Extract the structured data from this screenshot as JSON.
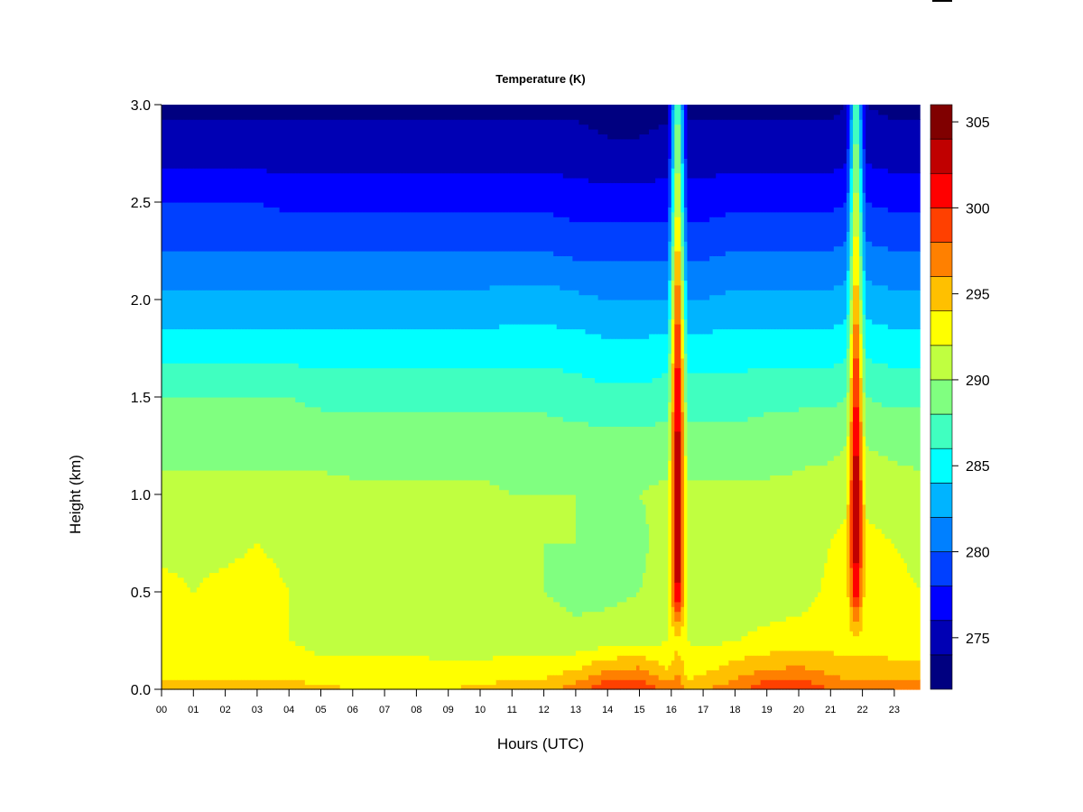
{
  "chart_data": {
    "type": "heatmap",
    "title": "Temperature (K)",
    "xlabel": "Hours (UTC)",
    "ylabel": "Height (km)",
    "xlim": [
      0,
      23.8
    ],
    "ylim": [
      0,
      3.0
    ],
    "x_ticks": [
      "00",
      "01",
      "02",
      "03",
      "04",
      "05",
      "06",
      "07",
      "08",
      "09",
      "10",
      "11",
      "12",
      "13",
      "14",
      "15",
      "16",
      "17",
      "18",
      "19",
      "20",
      "21",
      "22",
      "23"
    ],
    "y_ticks": [
      "0.0",
      "0.5",
      "1.0",
      "1.5",
      "2.0",
      "2.5",
      "3.0"
    ],
    "colorbar": {
      "levels_min": 272,
      "levels_max": 306,
      "level_step": 2,
      "ticks": [
        "275",
        "280",
        "285",
        "290",
        "295",
        "300",
        "305"
      ],
      "colors": [
        "#000080",
        "#0000B4",
        "#0000FF",
        "#0040FF",
        "#0080FF",
        "#00B4FF",
        "#00FFFF",
        "#40FFC0",
        "#80FF80",
        "#C0FF40",
        "#FFFF00",
        "#FFC000",
        "#FF8000",
        "#FF4000",
        "#FF0000",
        "#C00000",
        "#800000"
      ]
    },
    "heights_km": [
      0,
      0.1,
      0.25,
      0.5,
      0.75,
      1.0,
      1.25,
      1.5,
      1.75,
      2.0,
      2.25,
      2.5,
      2.75,
      3.0
    ],
    "hours": [
      0,
      1,
      2,
      3,
      4,
      5,
      6,
      7,
      8,
      9,
      10,
      11,
      12,
      13,
      14,
      15,
      15.9,
      16.2,
      16.5,
      17,
      18,
      19,
      20,
      21,
      21.5,
      21.8,
      22.1,
      23,
      23.8
    ],
    "temperature_by_hour": [
      [
        295,
        293,
        292,
        292.5,
        291.5,
        290.5,
        289.5,
        288,
        285,
        282.5,
        280,
        278,
        275,
        273.5
      ],
      [
        295,
        293,
        292,
        292,
        291.5,
        290.5,
        289.5,
        288,
        285,
        282.5,
        280,
        278,
        275,
        273.5
      ],
      [
        295,
        293,
        292,
        292.5,
        291.5,
        290.5,
        289.5,
        288,
        285,
        282.5,
        280,
        278,
        275,
        273.5
      ],
      [
        295,
        293,
        292,
        292.8,
        292,
        290.5,
        289.5,
        288,
        285,
        282.5,
        280,
        278,
        275,
        273.5
      ],
      [
        295,
        293,
        292,
        292,
        291.5,
        290.5,
        289.5,
        288,
        285,
        282.5,
        280,
        277.5,
        275,
        273.5
      ],
      [
        294.5,
        292.5,
        291.5,
        291.5,
        291,
        290.5,
        289.5,
        287.5,
        285,
        282.5,
        280,
        277.5,
        275,
        273.5
      ],
      [
        294,
        292.5,
        291.5,
        291,
        290.5,
        290.5,
        289,
        287.5,
        285,
        282.5,
        280,
        277.5,
        275,
        273.5
      ],
      [
        294,
        292.5,
        291.5,
        291,
        290.5,
        290.5,
        289,
        287.5,
        285,
        282.5,
        280,
        277.5,
        275,
        273.5
      ],
      [
        294,
        292.5,
        291.5,
        291,
        290.5,
        290.5,
        289,
        287.5,
        285,
        282.5,
        280,
        277.5,
        275,
        273.5
      ],
      [
        294,
        292.5,
        291,
        290.5,
        290.5,
        290.5,
        289,
        287.5,
        285,
        282.5,
        280,
        277.5,
        275,
        273.5
      ],
      [
        294.5,
        292.5,
        291,
        290.5,
        290.5,
        290.5,
        289,
        287.5,
        285,
        282.5,
        280,
        277.5,
        275,
        273.5
      ],
      [
        295,
        293,
        291,
        290,
        290,
        290,
        289,
        287.5,
        285,
        283,
        280,
        277.5,
        275,
        273.5
      ],
      [
        295.5,
        293,
        291,
        290,
        290,
        290,
        289,
        287.5,
        285,
        283,
        280,
        277.5,
        275,
        273.5
      ],
      [
        297,
        294,
        290.5,
        289.5,
        290,
        290,
        289,
        287,
        285,
        282.5,
        279.5,
        277,
        275,
        273.5
      ],
      [
        300,
        296,
        291,
        289.5,
        289.5,
        290,
        289,
        286.5,
        284.5,
        282,
        279.5,
        277,
        274.5,
        273
      ],
      [
        300,
        296.5,
        291,
        290,
        289.5,
        290,
        289,
        286.5,
        284.5,
        282,
        279.5,
        277,
        274.5,
        273
      ],
      [
        297,
        294,
        292,
        291,
        291,
        290.5,
        289,
        287,
        285,
        282,
        279.5,
        277,
        275,
        273.5
      ],
      [
        298,
        296,
        293,
        304,
        305,
        305.5,
        305,
        304,
        302,
        300,
        297,
        294,
        292,
        290
      ],
      [
        295,
        293,
        292,
        291,
        290.5,
        290.5,
        289,
        287,
        285,
        282,
        279.5,
        277,
        275,
        273.5
      ],
      [
        296,
        293.5,
        291.5,
        290.5,
        290.5,
        290.5,
        289,
        287,
        285,
        282,
        279.5,
        277,
        275,
        273.5
      ],
      [
        297,
        295,
        292,
        290.5,
        290.5,
        290.5,
        289,
        287,
        285,
        282.5,
        280,
        277.5,
        275,
        273.5
      ],
      [
        300,
        296,
        292.5,
        291,
        290.5,
        290.5,
        289,
        287.5,
        285,
        282.5,
        280,
        277.5,
        275,
        273.5
      ],
      [
        300,
        296.5,
        293,
        291,
        291,
        290.5,
        289.5,
        287.5,
        285,
        282.5,
        280,
        277.5,
        275,
        273.5
      ],
      [
        298,
        295.5,
        293,
        292.5,
        292,
        291,
        289.5,
        287.5,
        285,
        282.5,
        280,
        277.5,
        275,
        273.5
      ],
      [
        297,
        295,
        293,
        292.5,
        292.5,
        291.5,
        290,
        288,
        285.5,
        283,
        280.5,
        278,
        275.5,
        274
      ],
      [
        297,
        295,
        293,
        302,
        305,
        305.5,
        304,
        302,
        300,
        297,
        295,
        293,
        291,
        289
      ],
      [
        297,
        295,
        293,
        292.5,
        292.5,
        291.5,
        290,
        288,
        285.5,
        283,
        280.5,
        278,
        275.5,
        274
      ],
      [
        297,
        295,
        292.5,
        292.5,
        292,
        291,
        289.5,
        287.5,
        285,
        282.5,
        280,
        277.5,
        275,
        273.5
      ],
      [
        297,
        294.5,
        292.5,
        292,
        291.5,
        290.5,
        289.5,
        287.5,
        285,
        282.5,
        280,
        277.5,
        275,
        273.5
      ]
    ]
  }
}
